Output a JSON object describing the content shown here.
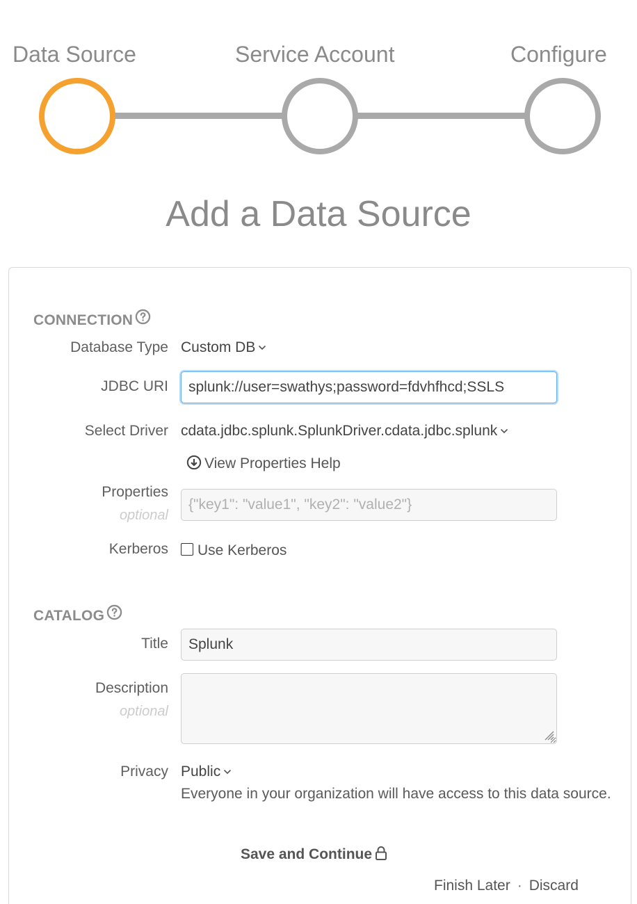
{
  "stepper": {
    "steps": [
      {
        "label": "Data Source",
        "state": "active"
      },
      {
        "label": "Service Account",
        "state": "pending"
      },
      {
        "label": "Configure",
        "state": "pending"
      }
    ],
    "active_color": "#f5a12f",
    "inactive_color": "#a9a9a9"
  },
  "page_title": "Add a Data Source",
  "connection": {
    "heading": "CONNECTION",
    "help_icon": "question-circle-icon",
    "database_type": {
      "label": "Database Type",
      "value": "Custom DB"
    },
    "jdbc_uri": {
      "label": "JDBC URI",
      "value": "splunk://user=swathys;password=fdvhfhcd;SSLS"
    },
    "select_driver": {
      "label": "Select Driver",
      "value": "cdata.jdbc.splunk.SplunkDriver.cdata.jdbc.splunk"
    },
    "view_properties_help": "View Properties Help",
    "properties": {
      "label": "Properties",
      "optional": "optional",
      "placeholder": "{\"key1\": \"value1\", \"key2\": \"value2\"}"
    },
    "kerberos": {
      "label": "Kerberos",
      "checkbox_label": "Use Kerberos",
      "checked": false
    }
  },
  "catalog": {
    "heading": "CATALOG",
    "help_icon": "question-circle-icon",
    "title": {
      "label": "Title",
      "value": "Splunk"
    },
    "description": {
      "label": "Description",
      "optional": "optional",
      "value": ""
    },
    "privacy": {
      "label": "Privacy",
      "value": "Public",
      "description": "Everyone in your organization will have access to this data source."
    }
  },
  "actions": {
    "save_label": "Save and Continue",
    "save_icon": "lock-icon",
    "finish_later": "Finish Later",
    "separator": "·",
    "discard": "Discard"
  }
}
